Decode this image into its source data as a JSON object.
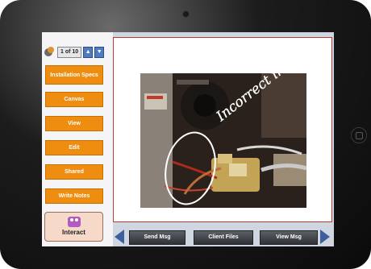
{
  "pager": {
    "count": "1 of 10"
  },
  "menu": [
    "Installation Specs",
    "Canvas",
    "View",
    "Edit",
    "Shared",
    "Write Notes"
  ],
  "interact": {
    "label": "Interact"
  },
  "photo": {
    "annotation": "Incorrect install?"
  },
  "bottombar": {
    "send": "Send Msg",
    "client_files": "Client Files",
    "view": "View Msg"
  },
  "colors": {
    "menu_orange": "#ef8d10",
    "panel_border": "#c0392b",
    "nav_blue": "#3d5f9b"
  }
}
